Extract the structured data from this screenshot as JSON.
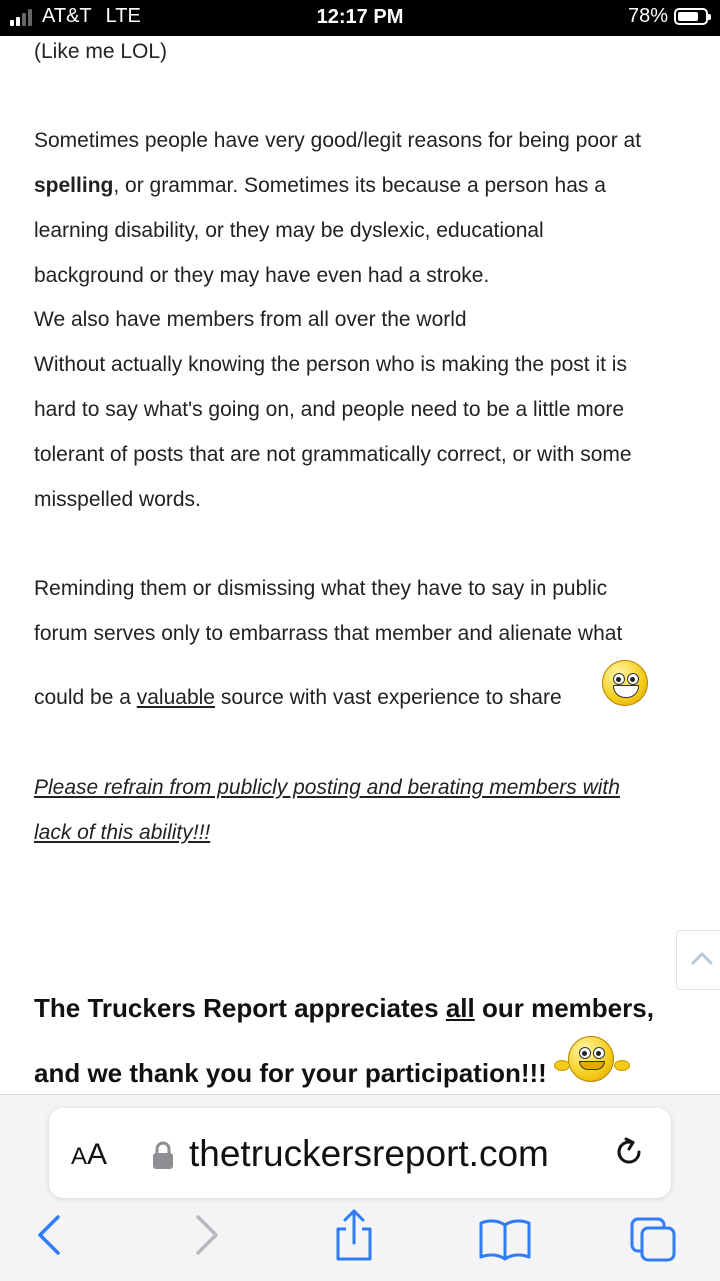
{
  "status_bar": {
    "carrier": "AT&T",
    "network": "LTE",
    "time": "12:17 PM",
    "battery_percent": "78%",
    "battery_level": 0.78,
    "signal_bars": 2
  },
  "post": {
    "line_top": "(Like me LOL)",
    "para1": {
      "l1": "Sometimes people have very good/legit reasons for being poor at",
      "l2_bold": "spelling",
      "l2_rest": ", or grammar. Sometimes its because a person has a",
      "l3": "learning disability, or they may be dyslexic, educational",
      "l4": "background or they may have even had a stroke.",
      "l5": "We also have members from all over the world",
      "l6": "Without actually knowing the person who is making the post it is",
      "l7": "hard to say what's going on, and people need to be a little more",
      "l8": "tolerant of posts that are not grammatically correct, or with some",
      "l9": "misspelled words."
    },
    "para2": {
      "l1": "Reminding them or dismissing what they have to say in public",
      "l2": "forum serves only to embarrass that member and alienate what",
      "l3_a": "could be a ",
      "l3_ul": "valuable",
      "l3_b": " source with vast experience to share"
    },
    "para3": {
      "l1": "Please refrain from publicly posting and berating members with",
      "l2": "lack of this ability!!!"
    },
    "closing": {
      "l1_a": "The Truckers Report appreciates ",
      "l1_ul": "all",
      "l1_b": " our members,",
      "l2": "and we thank you for your participation!!!"
    }
  },
  "browser": {
    "text_size_label_big": "A",
    "text_size_label_small": "A",
    "url": "thetruckersreport.com"
  },
  "icons": {
    "scroll_top": "chevron-up-icon",
    "back": "back-arrow-icon",
    "forward": "forward-arrow-icon",
    "share": "share-icon",
    "bookmarks": "book-icon",
    "tabs": "tabs-icon",
    "lock": "lock-icon",
    "reload": "reload-icon"
  },
  "colors": {
    "link_blue": "#1a73e8",
    "toolbar_blue": "#2f7cf6",
    "toolbar_disabled": "#b8b8bd"
  }
}
